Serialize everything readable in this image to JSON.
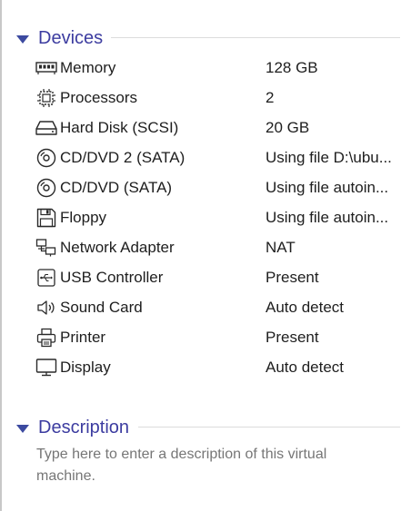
{
  "devices_section": {
    "title": "Devices",
    "items": [
      {
        "name": "Memory",
        "summary": "128 GB",
        "icon": "memory-icon"
      },
      {
        "name": "Processors",
        "summary": "2",
        "icon": "processor-icon"
      },
      {
        "name": "Hard Disk (SCSI)",
        "summary": "20 GB",
        "icon": "hard-disk-icon"
      },
      {
        "name": "CD/DVD 2 (SATA)",
        "summary": "Using file D:\\ubu...",
        "icon": "cd-dvd-icon"
      },
      {
        "name": "CD/DVD (SATA)",
        "summary": "Using file autoin...",
        "icon": "cd-dvd-icon"
      },
      {
        "name": "Floppy",
        "summary": "Using file autoin...",
        "icon": "floppy-icon"
      },
      {
        "name": "Network Adapter",
        "summary": "NAT",
        "icon": "network-adapter-icon"
      },
      {
        "name": "USB Controller",
        "summary": "Present",
        "icon": "usb-icon"
      },
      {
        "name": "Sound Card",
        "summary": "Auto detect",
        "icon": "speaker-icon"
      },
      {
        "name": "Printer",
        "summary": "Present",
        "icon": "printer-icon"
      },
      {
        "name": "Display",
        "summary": "Auto detect",
        "icon": "monitor-icon"
      }
    ]
  },
  "description_section": {
    "title": "Description",
    "placeholder": "Type here to enter a description of this virtual machine."
  },
  "colors": {
    "section_title": "#3c3ca0",
    "chevron": "#3c4aa0",
    "text": "#1e1e1e",
    "placeholder": "#767676"
  }
}
